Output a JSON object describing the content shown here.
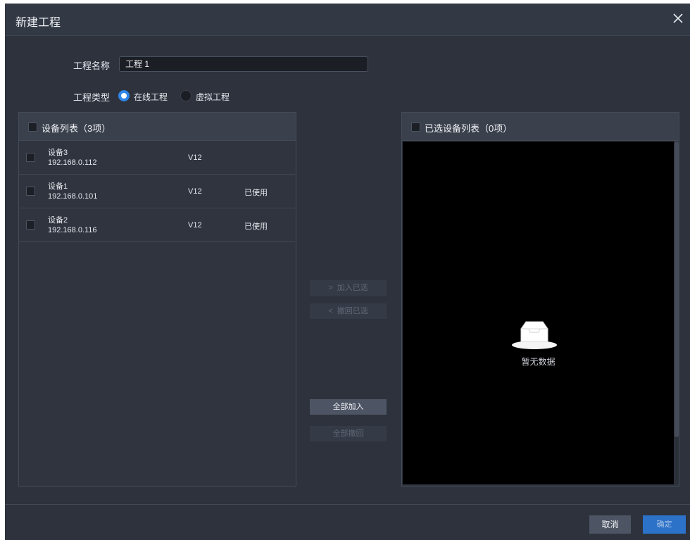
{
  "dialog": {
    "title": "新建工程",
    "project_name_label": "工程名称",
    "project_name_value": "工程 1",
    "project_type_label": "工程类型",
    "type_options": [
      {
        "label": "在线工程",
        "selected": true
      },
      {
        "label": "虚拟工程",
        "selected": false
      }
    ]
  },
  "device_list": {
    "title": "设备列表（3项）",
    "devices": [
      {
        "name": "设备3",
        "ip": "192.168.0.112",
        "version": "V12",
        "status": ""
      },
      {
        "name": "设备1",
        "ip": "192.168.0.101",
        "version": "V12",
        "status": "已使用"
      },
      {
        "name": "设备2",
        "ip": "192.168.0.116",
        "version": "V12",
        "status": "已使用"
      }
    ]
  },
  "transfer": {
    "add_selected": "加入已选",
    "remove_selected": "撤回已选",
    "add_all": "全部加入",
    "remove_all": "全部撤回",
    "chevron_right": ">",
    "chevron_left": "<"
  },
  "selected_list": {
    "title": "已选设备列表（0项）",
    "empty_text": "暂无数据"
  },
  "footer": {
    "cancel": "取消",
    "confirm": "确定"
  },
  "colors": {
    "background": "#2d323c",
    "accent": "#2f86e8",
    "confirm_button": "#2c72c9"
  },
  "icons": {
    "close": "close-icon",
    "empty": "empty-box-icon"
  }
}
